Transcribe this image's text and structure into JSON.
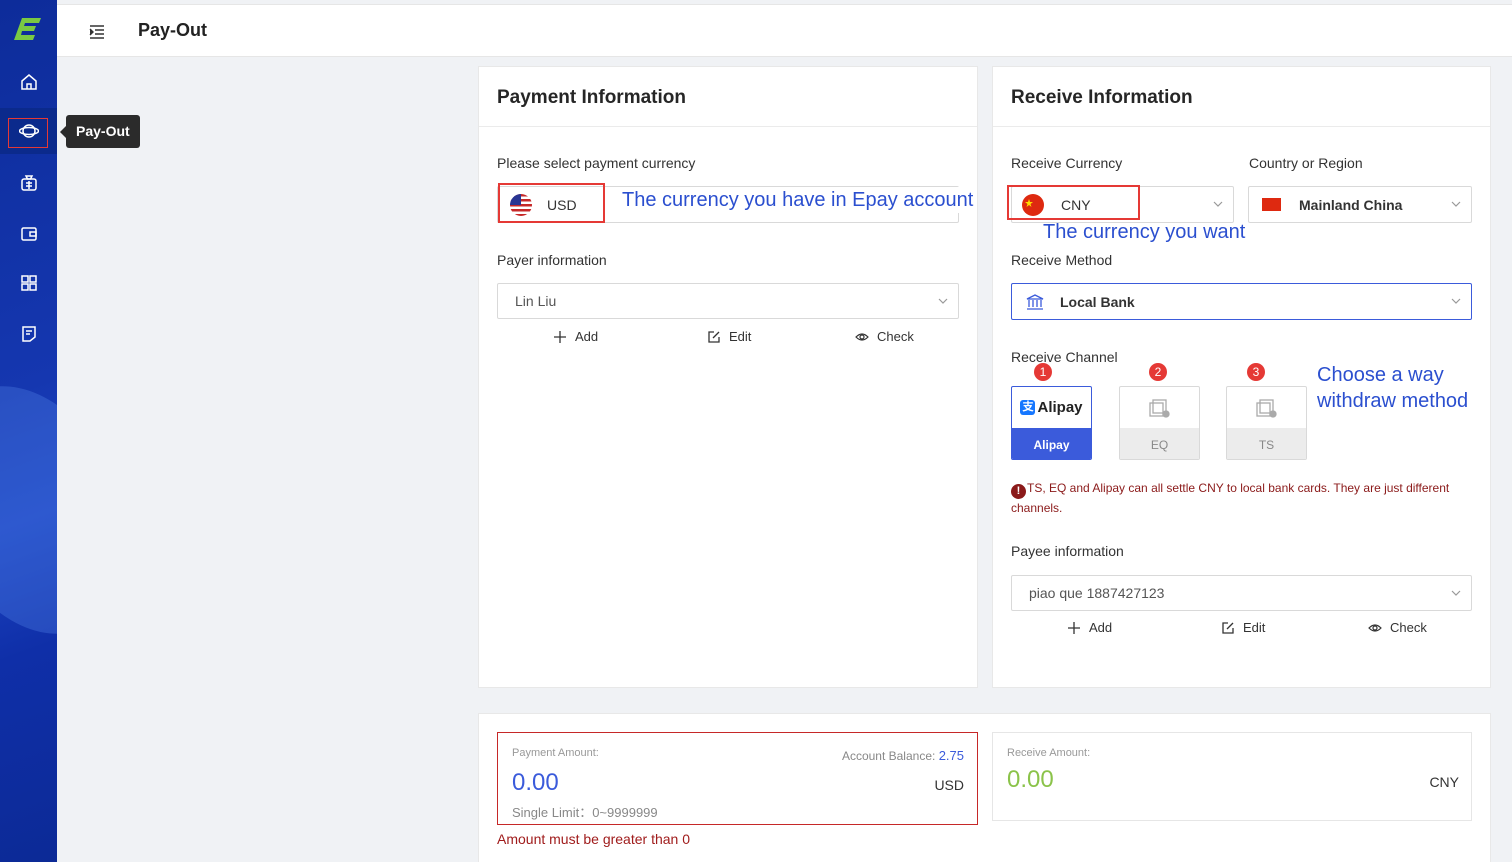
{
  "app": {
    "page_title": "Pay-Out",
    "tooltip": "Pay-Out"
  },
  "sidebar": {
    "items": [
      {
        "name": "home",
        "icon": "home-icon"
      },
      {
        "name": "pay-out",
        "icon": "planet-icon",
        "active": true
      },
      {
        "name": "exchange",
        "icon": "money-bag-icon"
      },
      {
        "name": "wallet",
        "icon": "wallet-icon"
      },
      {
        "name": "apps",
        "icon": "grid-icon"
      },
      {
        "name": "orders",
        "icon": "document-icon"
      }
    ]
  },
  "payment": {
    "title": "Payment Information",
    "currency_label": "Please select payment currency",
    "currency": "USD",
    "currency_annotation": "The currency you have in Epay account",
    "payer_label": "Payer information",
    "payer": "Lin Liu",
    "actions": {
      "add": "Add",
      "edit": "Edit",
      "check": "Check"
    }
  },
  "receive": {
    "title": "Receive Information",
    "currency_label": "Receive Currency",
    "currency": "CNY",
    "currency_annotation": "The currency you want",
    "region_label": "Country or Region",
    "region": "Mainland China",
    "method_label": "Receive Method",
    "method": "Local Bank",
    "channel_label": "Receive Channel",
    "channels": [
      {
        "badge": "1",
        "name": "Alipay",
        "logo_text": "Alipay",
        "selected": true
      },
      {
        "badge": "2",
        "name": "EQ",
        "selected": false
      },
      {
        "badge": "3",
        "name": "TS",
        "selected": false
      }
    ],
    "channel_annotation": [
      "Choose a way",
      "withdraw method"
    ],
    "warning_mark": "!",
    "warning_line1": "TS, EQ and Alipay can all settle CNY to local bank cards. They are just different",
    "warning_line2": "channels.",
    "payee_label": "Payee information",
    "payee": "piao que 1887427123",
    "actions": {
      "add": "Add",
      "edit": "Edit",
      "check": "Check"
    }
  },
  "amounts": {
    "payment_label": "Payment Amount:",
    "balance_label": "Account Balance:",
    "balance": "2.75",
    "payment_value": "0.00",
    "payment_currency": "USD",
    "limit": "Single Limit：0~9999999",
    "error": "Amount must be greater than 0",
    "receive_label": "Receive Amount:",
    "receive_value": "0.00",
    "receive_currency": "CNY"
  },
  "colors": {
    "sidebar": "#0d2c9a",
    "accent": "#3b5bdb",
    "highlight": "#e53935",
    "receive_amount": "#8bc34a"
  }
}
